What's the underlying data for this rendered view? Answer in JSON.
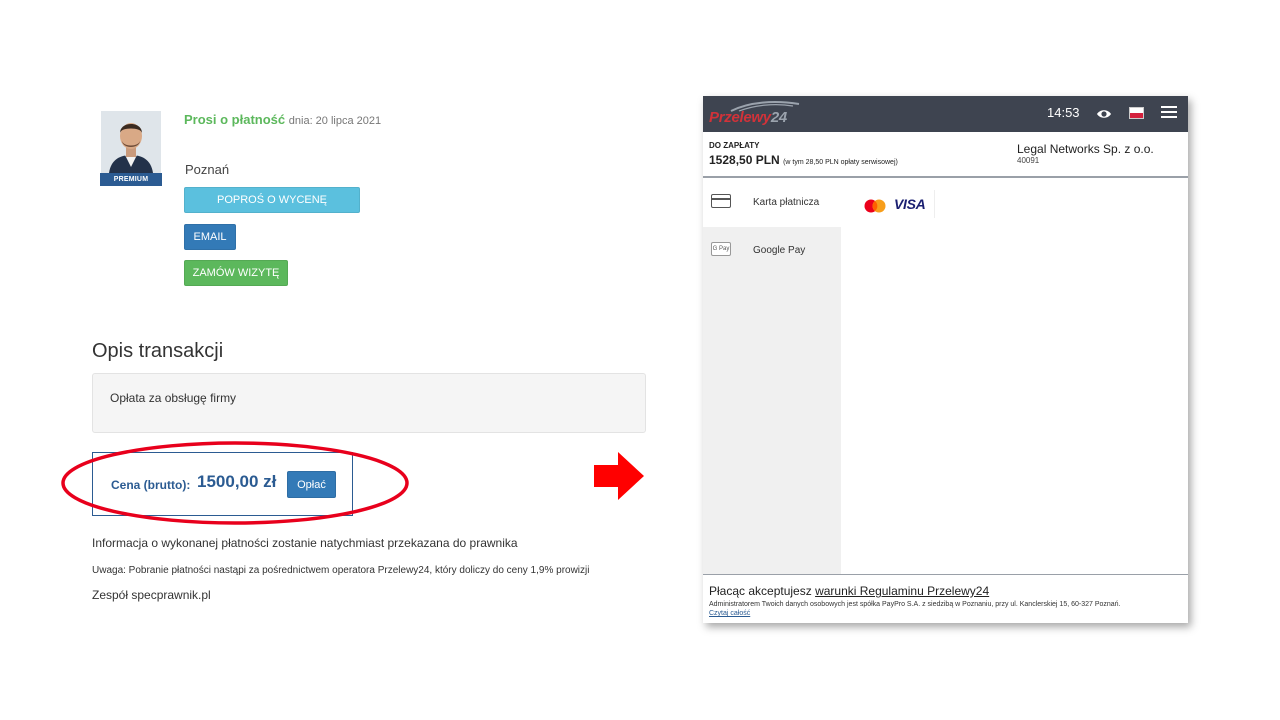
{
  "left": {
    "badge": "PREMIUM",
    "request_label": "Prosi o płatność",
    "request_date": "dnia: 20 lipca 2021",
    "city": "Poznań",
    "buttons": {
      "quote": "POPROŚ O WYCENĘ",
      "email": "EMAIL",
      "visit": "ZAMÓW WIZYTĘ"
    },
    "section_title": "Opis transakcji",
    "description": "Opłata za obsługę firmy",
    "price_label": "Cena (brutto):",
    "price_value": "1500,00 zł",
    "pay_button": "Opłać",
    "info": "Informacja o wykonanej płatności zostanie natychmiast przekazana do prawnika",
    "note": "Uwaga: Pobranie płatności nastąpi za pośrednictwem operatora Przelewy24, który doliczy do ceny 1,9% prowizji",
    "team": "Zespół specprawnik.pl"
  },
  "p24": {
    "logo_main": "Przelewy",
    "logo_num": "24",
    "time": "14:53",
    "due_label": "DO ZAPŁATY",
    "due_amount": "1528,50 PLN",
    "due_fee": "(w tym 28,50 PLN opłaty serwisowej)",
    "merchant": "Legal Networks Sp. z o.o.",
    "merchant_id": "40091",
    "methods": [
      {
        "label": "Karta płatnicza",
        "icon": "credit-card-icon"
      },
      {
        "label": "Google Pay",
        "icon": "google-pay-icon",
        "icon_text": "G Pay"
      }
    ],
    "brands": {
      "visa": "VISA"
    },
    "accept_prefix": "Płacąc akceptujesz ",
    "accept_link": "warunki Regulaminu Przelewy24",
    "admin": "Administratorem Twoich danych osobowych jest spółka PayPro S.A. z siedzibą w Poznaniu, przy ul. Kanclerskiej 15, 60-327 Poznań.",
    "read_more": "Czytaj całość"
  },
  "colors": {
    "accent_blue": "#337ab7",
    "success_green": "#5cb85c",
    "info_cyan": "#5bc0de",
    "annotation_red": "#e8001c",
    "p24_red": "#d13239"
  }
}
